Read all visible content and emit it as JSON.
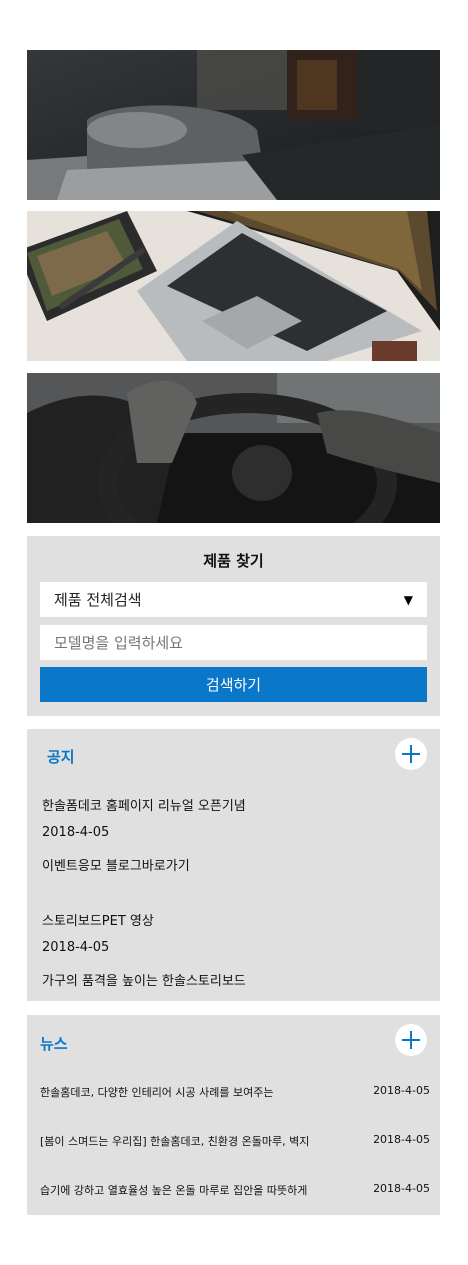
{
  "banners": [
    {
      "name": "bedroom-banner"
    },
    {
      "name": "laptop-banner"
    },
    {
      "name": "car-steering-banner"
    }
  ],
  "search": {
    "title": "제품 찾기",
    "select_value": "제품 전체검색",
    "input_placeholder": "모델명을 입력하세요",
    "button_label": "검색하기",
    "caret_icon": "▼"
  },
  "notice": {
    "title": "공지",
    "more_icon": "plus-icon",
    "items": [
      {
        "title": "한솔폼데코 홈페이지 리뉴얼 오픈기념",
        "date": "2018-4-05",
        "desc": "이벤트응모 블로그바로가기"
      },
      {
        "title": "스토리보드PET 영상",
        "date": "2018-4-05",
        "desc": "가구의 품격을 높이는 한솔스토리보드"
      }
    ]
  },
  "news": {
    "title": "뉴스",
    "more_icon": "plus-icon",
    "items": [
      {
        "title": "한솔홈데코, 다양한 인테리어 시공 사례를 보여주는",
        "date": "2018-4-05"
      },
      {
        "title": "[봄이 스며드는 우리집] 한솔홈데코, 친환경 온돌마루, 벽지",
        "date": "2018-4-05"
      },
      {
        "title": "습기에 강하고 열효율성 높은 온돌 마루로 집안을 따뜻하게",
        "date": "2018-4-05"
      }
    ]
  }
}
